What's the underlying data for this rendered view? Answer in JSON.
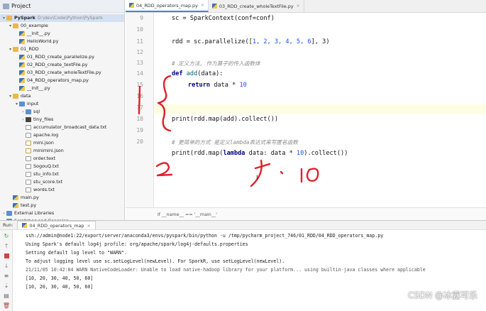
{
  "sidebar": {
    "header": "Project",
    "items": [
      {
        "label": "PySpark",
        "path": "D:\\dev\\Code\\Python\\PySpark",
        "kind": "folder",
        "depth": 0,
        "open": true,
        "bold": true
      },
      {
        "label": "00_example",
        "kind": "folder",
        "depth": 1,
        "open": true
      },
      {
        "label": "__init__.py",
        "kind": "py",
        "depth": 2
      },
      {
        "label": "HelloWorld.py",
        "kind": "py",
        "depth": 2
      },
      {
        "label": "01_RDD",
        "kind": "folder",
        "depth": 1,
        "open": true
      },
      {
        "label": "01_RDD_create_parallelize.py",
        "kind": "py",
        "depth": 2
      },
      {
        "label": "02_RDD_create_textFile.py",
        "kind": "py",
        "depth": 2
      },
      {
        "label": "03_RDD_create_wholeTextFile.py",
        "kind": "py",
        "depth": 2
      },
      {
        "label": "04_RDD_operators_map.py",
        "kind": "py",
        "depth": 2
      },
      {
        "label": "__init__.py",
        "kind": "py",
        "depth": 2
      },
      {
        "label": "data",
        "kind": "folder",
        "depth": 1,
        "open": true
      },
      {
        "label": "input",
        "kind": "folder-blue",
        "depth": 2,
        "open": true
      },
      {
        "label": "sql",
        "kind": "folder-blue",
        "depth": 3,
        "open": false
      },
      {
        "label": "tiny_files",
        "kind": "folder-dark",
        "depth": 3,
        "open": false
      },
      {
        "label": "accumulator_broadcast_data.txt",
        "kind": "txt",
        "depth": 3
      },
      {
        "label": "apache.log",
        "kind": "log",
        "depth": 3
      },
      {
        "label": "mini.json",
        "kind": "json",
        "depth": 3
      },
      {
        "label": "minimini.json",
        "kind": "json",
        "depth": 3
      },
      {
        "label": "order.text",
        "kind": "txt",
        "depth": 3
      },
      {
        "label": "SogouQ.txt",
        "kind": "txt",
        "depth": 3
      },
      {
        "label": "stu_info.txt",
        "kind": "txt",
        "depth": 3
      },
      {
        "label": "stu_score.txt",
        "kind": "txt",
        "depth": 3
      },
      {
        "label": "words.txt",
        "kind": "txt",
        "depth": 3
      },
      {
        "label": "main.py",
        "kind": "py",
        "depth": 1
      },
      {
        "label": "test.py",
        "kind": "py",
        "depth": 1
      },
      {
        "label": "External Libraries",
        "kind": "folder-lib",
        "depth": 0,
        "open": false
      },
      {
        "label": "Scratches and Consoles",
        "kind": "folder-lib",
        "depth": 0,
        "open": false
      }
    ]
  },
  "editor": {
    "tabs": [
      {
        "label": "04_RDD_operators_map.py",
        "active": true
      },
      {
        "label": "03_RDD_create_wholeTextFile.py",
        "active": false
      }
    ],
    "close_glyph": "×",
    "line_numbers": [
      "9",
      "10",
      "11",
      "12",
      "13",
      "14",
      "15",
      "16",
      "17",
      "18",
      "19",
      "20"
    ],
    "lines": {
      "sc": "sc = SparkContext(conf=conf)",
      "rdd_a": "rdd = sc.parallelize([",
      "rdd_nums": "1, 2, 3, 4, 5, 6",
      "rdd_b": "], 3)",
      "comment1": "# 定义方法, 作为算子的传入函数体",
      "def_kw": "def",
      "def_name": "add",
      "def_rest": "(data):",
      "ret_kw": "return",
      "ret_rest": " data * ",
      "ret_num": "10",
      "print1": "print(rdd.map(add).collect())",
      "comment2": "# 更简单的方式 是定义lambda表达式来写匿名函数",
      "print2_a": "print(rdd.map(",
      "print2_kw": "lambda",
      "print2_b": " data: data * ",
      "print2_num": "10",
      "print2_c": ").collect())"
    },
    "breadcrumb": "if __name__ == '__main__'"
  },
  "run": {
    "label": "Run:",
    "tab": "04_RDD_operators_map",
    "close_glyph": "×",
    "console": [
      "ssh://admin@node1:22/export/server/anaconda3/envs/pyspark/bin/python -u /tmp/pycharm_project_746/01_RDD/04_RDD_operators_map.py",
      "Using Spark's default log4j profile: org/apache/spark/log4j-defaults.properties",
      "Setting default log level to \"WARN\".",
      "To adjust logging level use sc.setLogLevel(newLevel). For SparkR, use setLogLevel(newLevel).",
      "21/11/05 10:42:04 WARN NativeCodeLoader: Unable to load native-hadoop library for your platform... using builtin-java classes where applicable",
      "[10, 20, 30, 40, 50, 60]",
      "[10, 20, 30, 40, 50, 60]"
    ]
  },
  "annotations": {
    "label_two": "2",
    "label_x10": "x·10",
    "color": "#e0202a"
  },
  "watermark": "CSDN @冰露可乐",
  "colors": {
    "keyword": "#000080",
    "number": "#1750eb",
    "comment": "#8c8c8c",
    "selection": "#d5e1f2",
    "current_line": "#fdfde2"
  }
}
